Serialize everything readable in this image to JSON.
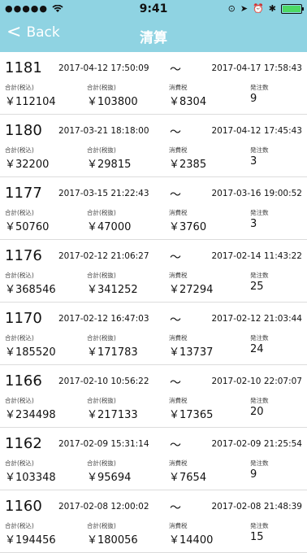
{
  "status": {
    "time": "9:41",
    "signal": "●●●●●"
  },
  "nav": {
    "back_label": "Back",
    "title": "清算"
  },
  "labels": {
    "total_incl_tax": "合計(税込)",
    "total_excl_tax": "合計(税抜)",
    "consumption_tax": "消費税",
    "order_count": "発注数"
  },
  "rows": [
    {
      "id": "1181",
      "start": "2017-04-12 17:50:09",
      "end": "2017-04-17 17:58:43",
      "incl": "￥112104",
      "excl": "￥103800",
      "tax": "￥8304",
      "count": "9"
    },
    {
      "id": "1180",
      "start": "2017-03-21 18:18:00",
      "end": "2017-04-12 17:45:43",
      "incl": "￥32200",
      "excl": "￥29815",
      "tax": "￥2385",
      "count": "3"
    },
    {
      "id": "1177",
      "start": "2017-03-15 21:22:43",
      "end": "2017-03-16 19:00:52",
      "incl": "￥50760",
      "excl": "￥47000",
      "tax": "￥3760",
      "count": "3"
    },
    {
      "id": "1176",
      "start": "2017-02-12 21:06:27",
      "end": "2017-02-14 11:43:22",
      "incl": "￥368546",
      "excl": "￥341252",
      "tax": "￥27294",
      "count": "25"
    },
    {
      "id": "1170",
      "start": "2017-02-12 16:47:03",
      "end": "2017-02-12 21:03:44",
      "incl": "￥185520",
      "excl": "￥171783",
      "tax": "￥13737",
      "count": "24"
    },
    {
      "id": "1166",
      "start": "2017-02-10 10:56:22",
      "end": "2017-02-10 22:07:07",
      "incl": "￥234498",
      "excl": "￥217133",
      "tax": "￥17365",
      "count": "20"
    },
    {
      "id": "1162",
      "start": "2017-02-09 15:31:14",
      "end": "2017-02-09 21:25:54",
      "incl": "￥103348",
      "excl": "￥95694",
      "tax": "￥7654",
      "count": "9"
    },
    {
      "id": "1160",
      "start": "2017-02-08 12:00:02",
      "end": "2017-02-08 21:48:39",
      "incl": "￥194456",
      "excl": "￥180056",
      "tax": "￥14400",
      "count": "15"
    }
  ],
  "tilde": "〜"
}
